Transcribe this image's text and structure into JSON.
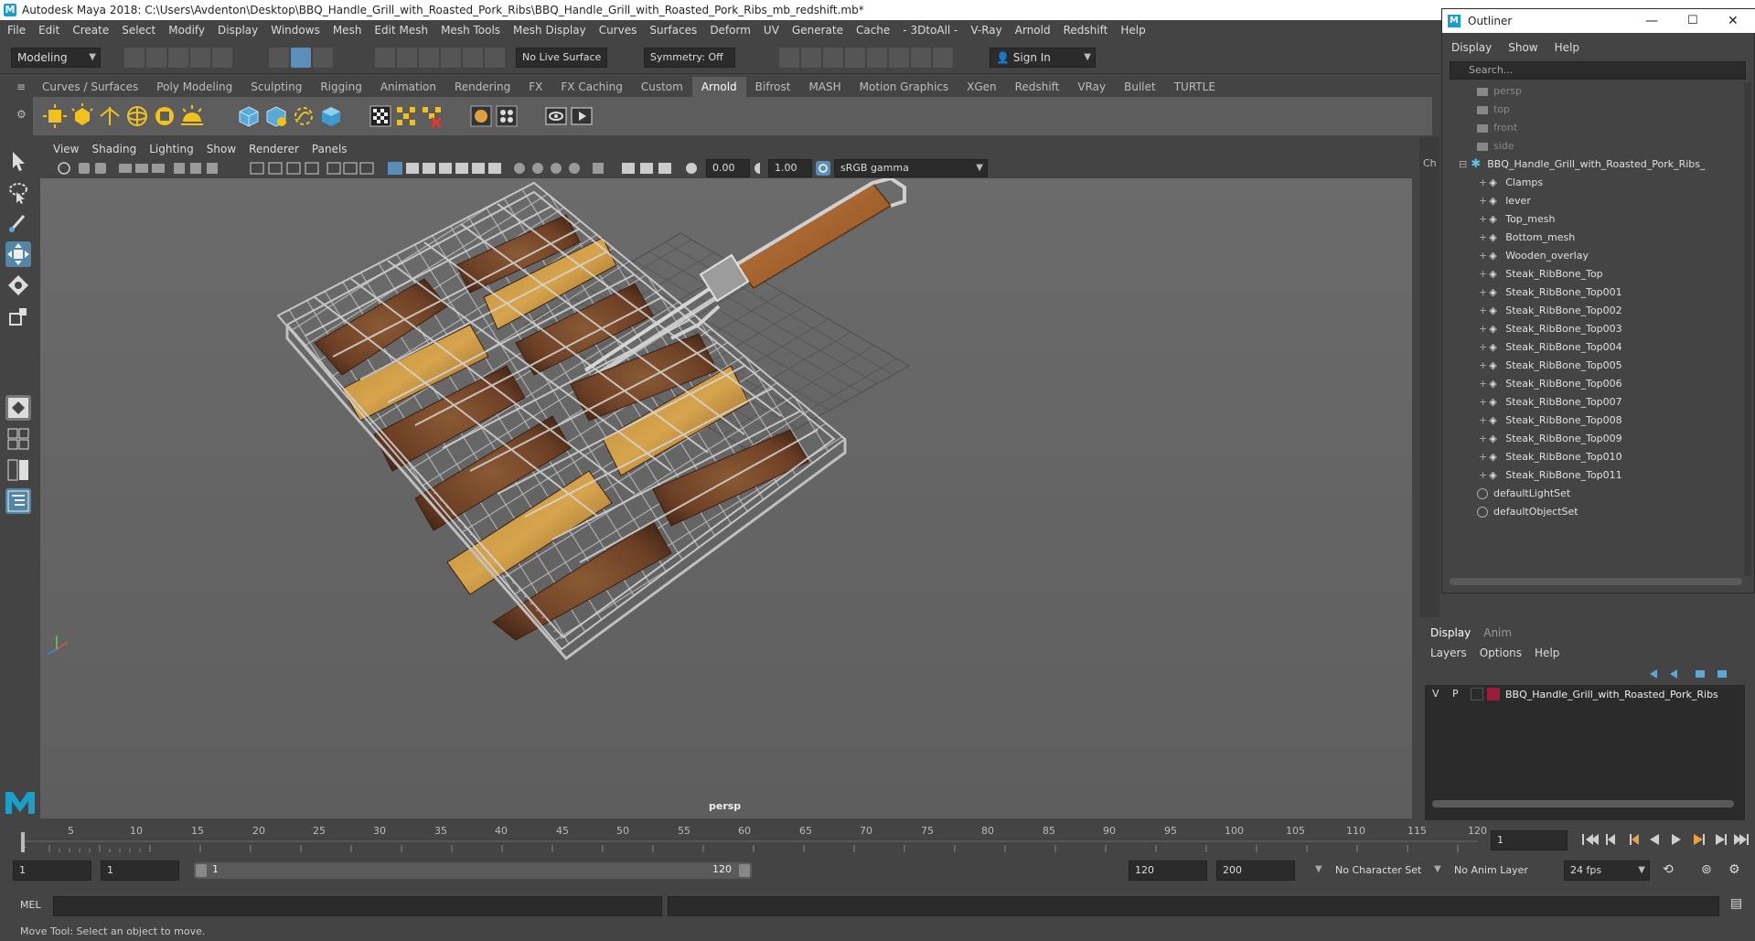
{
  "window": {
    "title": "Autodesk Maya 2018: C:\\Users\\Avdenton\\Desktop\\BBQ_Handle_Grill_with_Roasted_Pork_Ribs\\BBQ_Handle_Grill_with_Roasted_Pork_Ribs_mb_redshift.mb*"
  },
  "menubar": [
    "File",
    "Edit",
    "Create",
    "Select",
    "Modify",
    "Display",
    "Windows",
    "Mesh",
    "Edit Mesh",
    "Mesh Tools",
    "Mesh Display",
    "Curves",
    "Surfaces",
    "Deform",
    "UV",
    "Generate",
    "Cache",
    "- 3DtoAll -",
    "V-Ray",
    "Arnold",
    "Redshift",
    "Help"
  ],
  "statusline": {
    "mode": "Modeling",
    "live_surface": "No Live Surface",
    "symmetry": "Symmetry: Off",
    "signin": "Sign In"
  },
  "shelf": {
    "tabs": [
      "Curves / Surfaces",
      "Poly Modeling",
      "Sculpting",
      "Rigging",
      "Animation",
      "Rendering",
      "FX",
      "FX Caching",
      "Custom",
      "Arnold",
      "Bifrost",
      "MASH",
      "Motion Graphics",
      "XGen",
      "Redshift",
      "VRay",
      "Bullet",
      "TURTLE"
    ],
    "active": "Arnold"
  },
  "viewport": {
    "menu": [
      "View",
      "Shading",
      "Lighting",
      "Show",
      "Renderer",
      "Panels"
    ],
    "exposure": "0.00",
    "gamma": "1.00",
    "colorspace": "sRGB gamma",
    "camera_label": "persp"
  },
  "outliner": {
    "title": "Outliner",
    "menu": [
      "Display",
      "Show",
      "Help"
    ],
    "search_placeholder": "Search...",
    "cameras": [
      "persp",
      "top",
      "front",
      "side"
    ],
    "group": "BBQ_Handle_Grill_with_Roasted_Pork_Ribs_",
    "children": [
      "Clamps",
      "lever",
      "Top_mesh",
      "Bottom_mesh",
      "Wooden_overlay",
      "Steak_RibBone_Top",
      "Steak_RibBone_Top001",
      "Steak_RibBone_Top002",
      "Steak_RibBone_Top003",
      "Steak_RibBone_Top004",
      "Steak_RibBone_Top005",
      "Steak_RibBone_Top006",
      "Steak_RibBone_Top007",
      "Steak_RibBone_Top008",
      "Steak_RibBone_Top009",
      "Steak_RibBone_Top010",
      "Steak_RibBone_Top011"
    ],
    "sets": [
      "defaultLightSet",
      "defaultObjectSet"
    ]
  },
  "side_tab": "Ch",
  "layers": {
    "tabs": [
      "Display",
      "Anim"
    ],
    "menu": [
      "Layers",
      "Options",
      "Help"
    ],
    "row": {
      "v": "V",
      "p": "P",
      "name": "BBQ_Handle_Grill_with_Roasted_Pork_Ribs",
      "color": "#9c1d3a"
    }
  },
  "timeline": {
    "ticks": [
      "5",
      "10",
      "15",
      "20",
      "25",
      "30",
      "35",
      "40",
      "45",
      "50",
      "55",
      "60",
      "65",
      "70",
      "75",
      "80",
      "85",
      "90",
      "95",
      "100",
      "105",
      "110",
      "115",
      "120"
    ],
    "start_tick": "1",
    "current_frame": "1"
  },
  "range": {
    "start": "1",
    "playback_start": "1",
    "slider_start": "1",
    "slider_end": "120",
    "playback_end": "120",
    "end": "200",
    "character_set": "No Character Set",
    "anim_layer": "No Anim Layer",
    "fps": "24 fps"
  },
  "command": {
    "label": "MEL"
  },
  "help_line": "Move Tool: Select an object to move."
}
